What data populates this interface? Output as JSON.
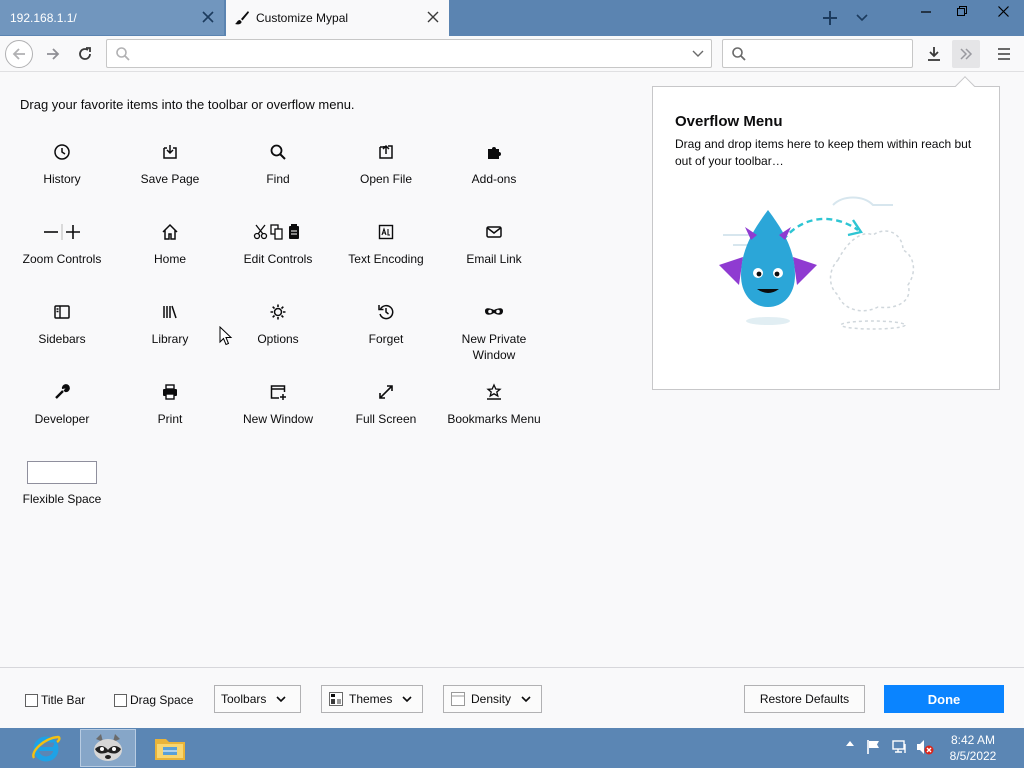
{
  "tabs": [
    {
      "label": "192.168.1.1/",
      "active": false
    },
    {
      "label": "Customize Mypal",
      "active": true
    }
  ],
  "navbar": {
    "url_value": "",
    "search_value": ""
  },
  "instructions": "Drag your favorite items into the toolbar or overflow menu.",
  "palette": [
    {
      "label": "History",
      "icon": "clock-icon"
    },
    {
      "label": "Save Page",
      "icon": "save-page-icon"
    },
    {
      "label": "Find",
      "icon": "magnifier-icon"
    },
    {
      "label": "Open File",
      "icon": "open-file-icon"
    },
    {
      "label": "Add-ons",
      "icon": "puzzle-icon"
    },
    {
      "label": "Zoom Controls",
      "icon": "zoom-icon"
    },
    {
      "label": "Home",
      "icon": "home-icon"
    },
    {
      "label": "Edit Controls",
      "icon": "edit-controls-icon"
    },
    {
      "label": "Text Encoding",
      "icon": "text-encoding-icon"
    },
    {
      "label": "Email Link",
      "icon": "envelope-icon"
    },
    {
      "label": "Sidebars",
      "icon": "sidebar-icon"
    },
    {
      "label": "Library",
      "icon": "library-icon"
    },
    {
      "label": "Options",
      "icon": "gear-icon"
    },
    {
      "label": "Forget",
      "icon": "forget-icon"
    },
    {
      "label": "New Private Window",
      "icon": "mask-icon"
    },
    {
      "label": "Developer",
      "icon": "wrench-icon"
    },
    {
      "label": "Print",
      "icon": "printer-icon"
    },
    {
      "label": "New Window",
      "icon": "new-window-icon"
    },
    {
      "label": "Full Screen",
      "icon": "fullscreen-icon"
    },
    {
      "label": "Bookmarks Menu",
      "icon": "bookmarks-menu-icon"
    },
    {
      "label": "Flexible Space",
      "icon": "flexible-space-box"
    }
  ],
  "overflow_panel": {
    "title": "Overflow Menu",
    "description": "Drag and drop items here to keep them within reach but out of your toolbar…"
  },
  "footer": {
    "title_bar_label": "Title Bar",
    "drag_space_label": "Drag Space",
    "toolbars_label": "Toolbars",
    "themes_label": "Themes",
    "density_label": "Density",
    "restore_label": "Restore Defaults",
    "done_label": "Done"
  },
  "taskbar": {
    "time": "8:42 AM",
    "date": "8/5/2022"
  },
  "colors": {
    "accent": "#0a84ff",
    "tabbar": "#5b84b1",
    "taskbar": "#5b86b4"
  }
}
